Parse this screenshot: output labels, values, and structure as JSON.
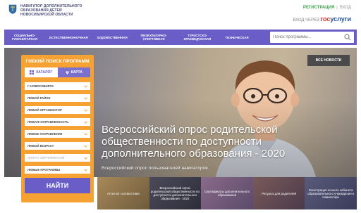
{
  "header": {
    "logo_lines": [
      "НАВИГАТОР ДОПОЛНИТЕЛЬНОГО",
      "ОБРАЗОВАНИЯ ДЕТЕЙ",
      "НОВОСИБИРСКОЙ ОБЛАСТИ"
    ],
    "register": "РЕГИСТРАЦИЯ",
    "separator": "|",
    "login": "ВХОД",
    "gosuslugi_prefix": "ВХОД ЧЕРЕЗ",
    "gosuslugi_gos": "гос",
    "gosuslugi_uslugi": "услуги"
  },
  "nav": {
    "items": [
      "СОЦИАЛЬНО-\nГУМАНИТАРНАЯ",
      "ЕСТЕСТВЕННОНАУЧНАЯ",
      "ХУДОЖЕСТВЕННАЯ",
      "ФИЗКУЛЬТУРНО-\nСПОРТИВНАЯ",
      "ТУРИСТСКО-\nКРАЕВЕДЧЕСКАЯ",
      "ТЕХНИЧЕСКАЯ"
    ],
    "search_placeholder": "Поиск программы..."
  },
  "filter": {
    "title": "ГИБКИЙ ПОИСК ПРОГРАММ",
    "catalog": "КАТАЛОГ",
    "map": "КАРТА",
    "selects": [
      "Г. НОВОСИБИРСК",
      "ЛЮБОЙ РАЙОН",
      "ЛЮБОЙ ОРГАНИЗАТОР",
      "ЛЮБАЯ НАПРАВЛЕННОСТЬ",
      "ЛЮБОЕ НАПРАВЛЕНИЕ",
      "ЛЮБОЙ ВОЗРАСТ",
      "ОПЛАТА СЕРТИФИКАТОМ",
      "ЛЮБЫЕ ПРОГРАММЫ"
    ],
    "find": "НАЙТИ"
  },
  "hero": {
    "all_news": "ВСЕ НОВОСТИ",
    "title": "Всероссийский опрос родительской общественности по доступности дополнительного образования - 2020",
    "subtitle": "Всероссийский опрос пользователей навигаторов"
  },
  "tiles": [
    "Аттестат соответствия",
    "Всероссийский опрос родительской общественности по доступности дополнительного образования - 2020",
    "Сертификаты дополнительного образования",
    "Ресурсы для родителей",
    "Регистрация личного кабинета образовательного учреждения в Навигаторе"
  ],
  "colors": {
    "nav": "#6a5dc8",
    "filter": "#f5a233",
    "register": "#3aa54a",
    "gos_blue": "#1f4e9c",
    "gos_red": "#e0322d"
  }
}
